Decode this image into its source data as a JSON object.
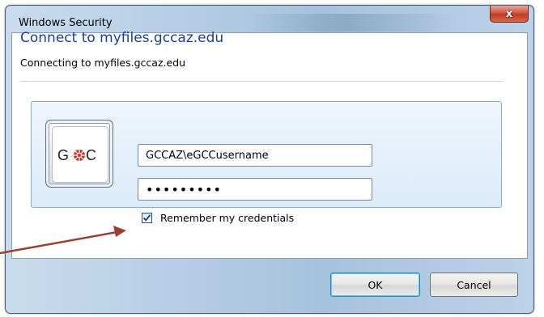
{
  "window": {
    "title": "Windows Security",
    "close_label": "x"
  },
  "dialog": {
    "heading": "Connect to myfiles.gccaz.edu",
    "subheading": "Connecting to myfiles.gccaz.edu"
  },
  "credentials": {
    "avatar_text": "G C",
    "username_value": "GCCAZ\\eGCCusername",
    "password_value": "•••••••••",
    "remember_label": "Remember my credentials",
    "remember_checked": true
  },
  "buttons": {
    "ok_label": "OK",
    "cancel_label": "Cancel"
  },
  "annotation": {
    "arrow_color": "#9b3f33"
  },
  "colors": {
    "heading": "#1a3f93",
    "panel_border": "#84acd6",
    "close_button": "#c23a22"
  }
}
